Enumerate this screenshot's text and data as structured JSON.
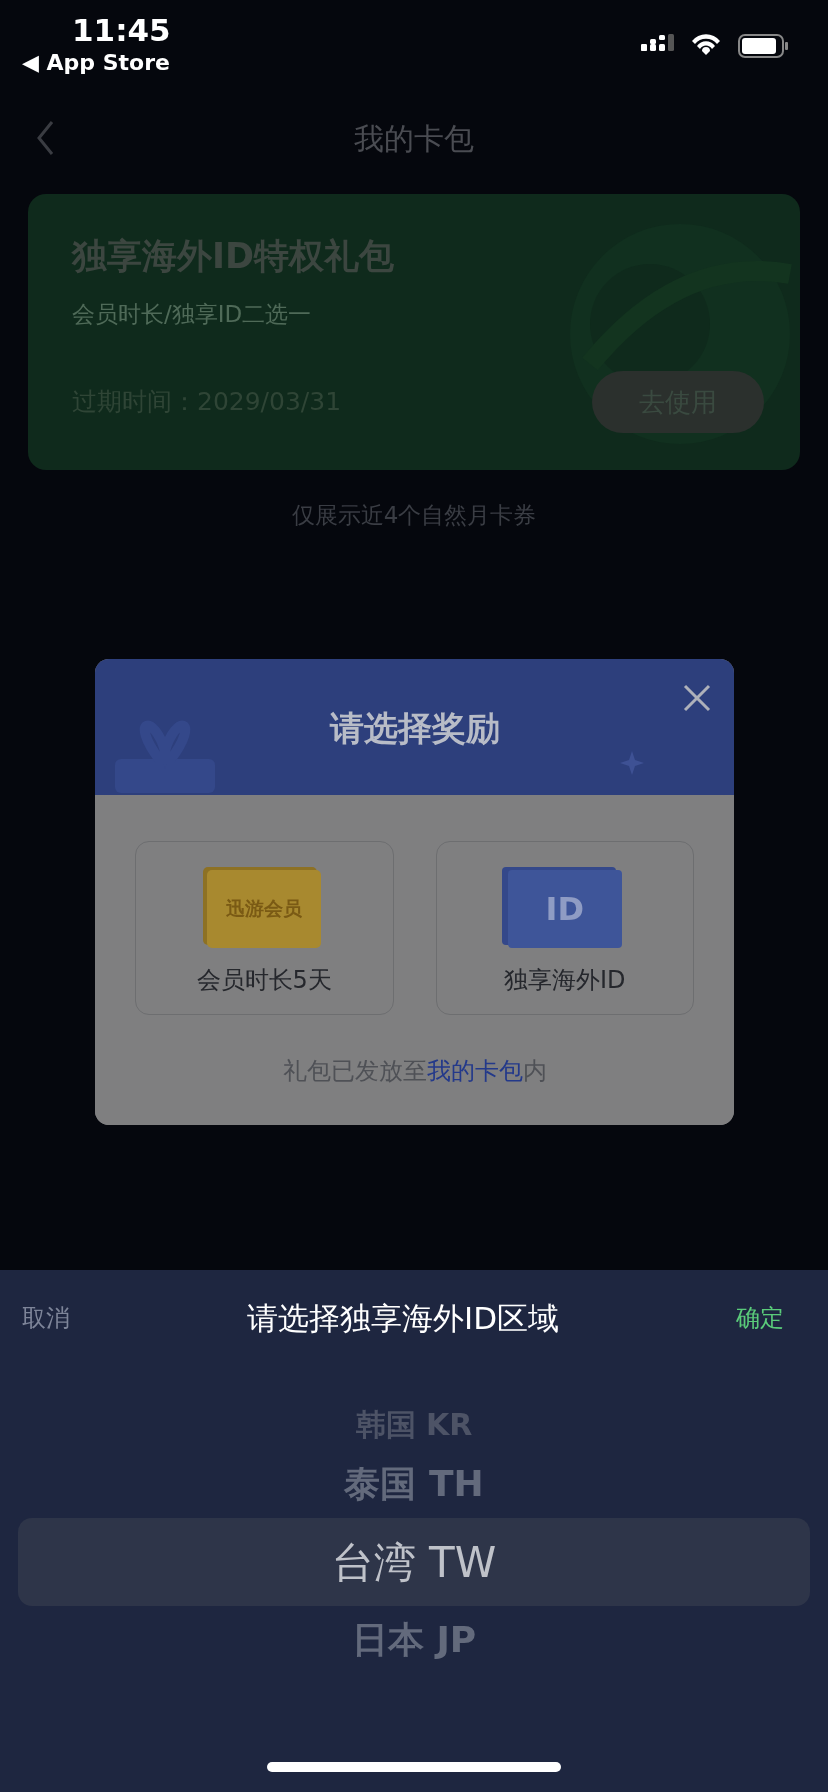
{
  "status_bar": {
    "time": "11:45",
    "back_app": "◀ App Store"
  },
  "nav": {
    "title": "我的卡包"
  },
  "coupon": {
    "title": "独享海外ID特权礼包",
    "subtitle": "会员时长/独享ID二选一",
    "expiry": "过期时间：2029/03/31",
    "button": "去使用"
  },
  "note": "仅展示近4个自然月卡券",
  "dialog": {
    "title": "请选择奖励",
    "options": [
      {
        "kind": "membership",
        "card_text": "迅游会员",
        "label": "会员时长5天"
      },
      {
        "kind": "id",
        "card_text": "ID",
        "label": "独享海外ID"
      }
    ],
    "footer_text": "礼包已发放至",
    "footer_link": "我的卡包",
    "footer_end": "内"
  },
  "picker": {
    "cancel": "取消",
    "title": "请选择独享海外ID区域",
    "confirm": "确定",
    "items": [
      {
        "label": "韩国 KR",
        "selected": false
      },
      {
        "label": "泰国 TH",
        "selected": false
      },
      {
        "label": "台湾 TW",
        "selected": true
      },
      {
        "label": "日本 JP",
        "selected": false
      }
    ]
  }
}
